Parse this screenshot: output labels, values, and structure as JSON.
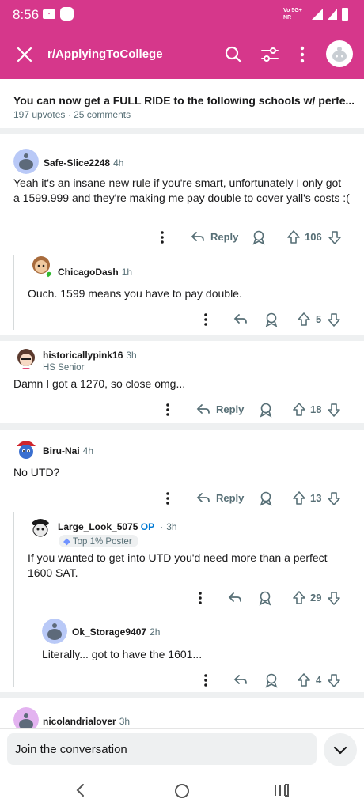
{
  "status": {
    "time": "8:56",
    "network_top": "Vo 5G+",
    "network_bottom": "NR"
  },
  "app": {
    "subreddit": "r/ApplyingToCollege"
  },
  "post": {
    "title": "You can now get a FULL RIDE to the following schools w/ perfe...",
    "upvotes": "197 upvotes",
    "comments": "25 comments"
  },
  "comments": [
    {
      "user": "Safe-Slice2248",
      "age": "4h",
      "text": "Yeah it's an insane new rule if you're smart, unfortunately I only got a 1599.999 and they're making me pay double to cover yall's costs :(",
      "score": "106",
      "reply": "Reply"
    },
    {
      "user": "ChicagoDash",
      "age": "1h",
      "text": "Ouch. 1599 means you have to pay double.",
      "score": "5"
    },
    {
      "user": "historicallypink16",
      "age": "3h",
      "flair": "HS Senior",
      "text": "Damn I got a 1270, so close omg...",
      "score": "18",
      "reply": "Reply"
    },
    {
      "user": "Biru-Nai",
      "age": "4h",
      "text": "No UTD?",
      "score": "13",
      "reply": "Reply"
    },
    {
      "user": "Large_Look_5075",
      "op": "OP",
      "age": "3h",
      "badge": "Top 1% Poster",
      "text": "If you wanted to get into UTD you'd need more than a perfect 1600 SAT.",
      "score": "29"
    },
    {
      "user": "Ok_Storage9407",
      "age": "2h",
      "text": "Literally... got to have the 1601...",
      "score": "4"
    },
    {
      "user": "nicolandrialover",
      "age": "3h"
    }
  ],
  "bottom": {
    "join": "Join the conversation"
  },
  "colors": {
    "brand": "#d6378b",
    "meta": "#576f76"
  }
}
